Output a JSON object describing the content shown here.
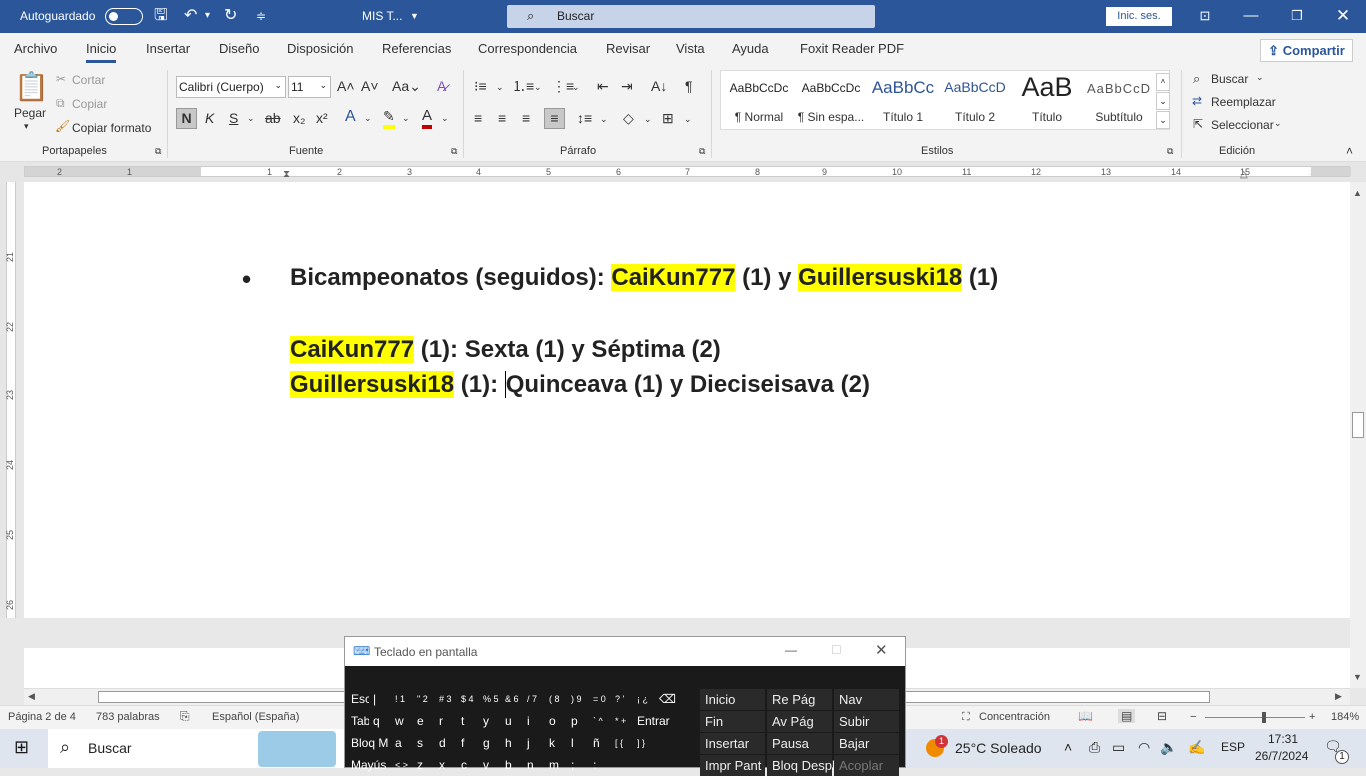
{
  "titlebar": {
    "autosave": "Autoguardado",
    "doc_title": "MIS T...",
    "search_placeholder": "Buscar",
    "signin": "Inic. ses."
  },
  "tabs": [
    "Archivo",
    "Inicio",
    "Insertar",
    "Diseño",
    "Disposición",
    "Referencias",
    "Correspondencia",
    "Revisar",
    "Vista",
    "Ayuda",
    "Foxit Reader PDF"
  ],
  "share": "Compartir",
  "clipboard": {
    "paste": "Pegar",
    "cut": "Cortar",
    "copy": "Copiar",
    "format_painter": "Copiar formato",
    "label": "Portapapeles"
  },
  "font": {
    "name": "Calibri (Cuerpo)",
    "size": "11",
    "label": "Fuente"
  },
  "paragraph": {
    "label": "Párrafo"
  },
  "styles": {
    "label": "Estilos",
    "items": [
      {
        "preview": "AaBbCcDc",
        "name": "¶ Normal"
      },
      {
        "preview": "AaBbCcDc",
        "name": "¶ Sin espa..."
      },
      {
        "preview": "AaBbCc",
        "name": "Título 1"
      },
      {
        "preview": "AaBbCcD",
        "name": "Título 2"
      },
      {
        "preview": "AaB",
        "name": "Título"
      },
      {
        "preview": "AaBbCcD",
        "name": "Subtítulo"
      }
    ]
  },
  "editing": {
    "find": "Buscar",
    "replace": "Reemplazar",
    "select": "Seleccionar",
    "label": "Edición"
  },
  "ruler": {
    "h": [
      "2",
      "1",
      "1",
      "2",
      "3",
      "4",
      "5",
      "6",
      "7",
      "8",
      "9",
      "10",
      "11",
      "12",
      "13",
      "14",
      "15",
      "16"
    ],
    "v": [
      "21",
      "22",
      "23",
      "24",
      "25",
      "26",
      "27"
    ]
  },
  "document": {
    "bullet": "•",
    "line1": {
      "a": "Bicampeonatos (seguidos): ",
      "b": "CaiKun777",
      "c": " (1) y ",
      "d": "Guillersuski18",
      "e": " (1)"
    },
    "line2": {
      "a": "CaiKun777",
      "b": " (1): Sexta (1) y Séptima (2)"
    },
    "line3": {
      "a": "Guillersuski18",
      "b": " (1): ",
      "c": "Quinceava (1) y Dieciseisava (2)"
    }
  },
  "status": {
    "page": "Página 2 de 4",
    "words": "783 palabras",
    "language": "Español (España)",
    "focus": "Concentración",
    "zoom": "184%"
  },
  "osk": {
    "title": "Teclado en pantalla",
    "row1": [
      "Esc",
      "|",
      "!\n1",
      "\"\n2",
      "#\n3",
      "$\n4",
      "%\n5",
      "&\n6",
      "/\n7",
      "(\n8",
      ")\n9",
      "=\n0",
      "?\n'",
      "¡\n¿",
      "⌫"
    ],
    "row2": [
      "Tab",
      "q",
      "w",
      "e",
      "r",
      "t",
      "y",
      "u",
      "i",
      "o",
      "p",
      "`\n^",
      "*\n+",
      "Entrar"
    ],
    "row3": [
      "Bloq M",
      "a",
      "s",
      "d",
      "f",
      "g",
      "h",
      "j",
      "k",
      "l",
      "ñ",
      "[\n{",
      "]\n}"
    ],
    "row4": [
      "Mayús",
      "<\n>",
      "z",
      "x",
      "c",
      "v",
      "b",
      "n",
      "m",
      ";",
      ":"
    ],
    "nav": [
      [
        "Inicio",
        "Re Pág",
        "Nav"
      ],
      [
        "Fin",
        "Av Pág",
        "Subir"
      ],
      [
        "Insertar",
        "Pausa",
        "Bajar"
      ],
      [
        "Impr Pant",
        "Bloq Despl",
        "Acoplar"
      ]
    ]
  },
  "taskbar": {
    "search": "Buscar",
    "weather": "25°C  Soleado",
    "lang": "ESP",
    "time": "17:31",
    "date": "26/7/2024",
    "badge": "1",
    "notif": "1"
  }
}
